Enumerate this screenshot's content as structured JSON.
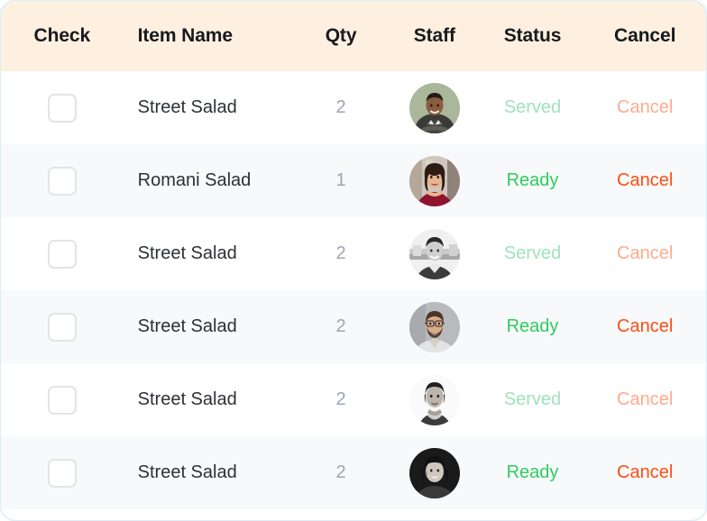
{
  "table": {
    "columns": [
      {
        "key": "check",
        "label": "Check"
      },
      {
        "key": "item",
        "label": "Item Name"
      },
      {
        "key": "qty",
        "label": "Qty"
      },
      {
        "key": "staff",
        "label": "Staff"
      },
      {
        "key": "status",
        "label": "Status"
      },
      {
        "key": "cancel",
        "label": "Cancel"
      }
    ],
    "rows": [
      {
        "checked": false,
        "item_name": "Street Salad",
        "qty": "2",
        "staff_avatar": "avatar-man-plaid-shirt",
        "status": "Served",
        "status_color": "#9ee3bc",
        "cancel": "Cancel",
        "cancel_color": "#ffab8d"
      },
      {
        "checked": false,
        "item_name": "Romani Salad",
        "qty": "1",
        "staff_avatar": "avatar-woman-red-top",
        "status": "Ready",
        "status_color": "#2ecc5f",
        "cancel": "Cancel",
        "cancel_color": "#ff4d14"
      },
      {
        "checked": false,
        "item_name": "Street Salad",
        "qty": "2",
        "staff_avatar": "avatar-man-grayscale",
        "status": "Served",
        "status_color": "#9ee3bc",
        "cancel": "Cancel",
        "cancel_color": "#ffab8d"
      },
      {
        "checked": false,
        "item_name": "Street Salad",
        "qty": "2",
        "staff_avatar": "avatar-man-beard-glasses",
        "status": "Ready",
        "status_color": "#2ecc5f",
        "cancel": "Cancel",
        "cancel_color": "#ff4d14"
      },
      {
        "checked": false,
        "item_name": "Street Salad",
        "qty": "2",
        "staff_avatar": "avatar-woman-short-hair",
        "status": "Served",
        "status_color": "#9ee3bc",
        "cancel": "Cancel",
        "cancel_color": "#ffab8d"
      },
      {
        "checked": false,
        "item_name": "Street Salad",
        "qty": "2",
        "staff_avatar": "avatar-woman-smiling-dark",
        "status": "Ready",
        "status_color": "#2ecc5f",
        "cancel": "Cancel",
        "cancel_color": "#ff4d14"
      }
    ]
  },
  "theme": {
    "header_background": "#fdf0e0",
    "header_text": "#17191c",
    "row_background": "#ffffff",
    "row_alt_background": "#f7f9fa",
    "item_text": "#2d3034",
    "qty_text": "#9aa5b5",
    "checkbox_border": "#e2e4e8",
    "card_border": "#d9eefb"
  }
}
